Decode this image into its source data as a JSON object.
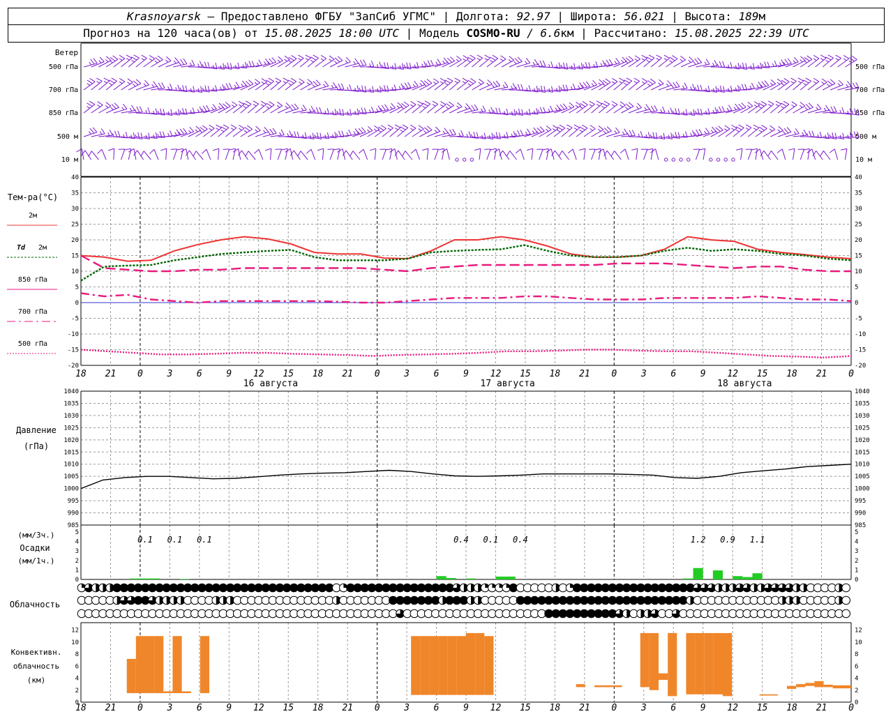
{
  "header": {
    "line1": {
      "city": "Krasnoyarsk",
      "sep": " — ",
      "provider": "Предоставлено ФГБУ \"ЗапСиб УГМС\"",
      "lon_label": "Долгота:",
      "lon_value": "92.97",
      "lat_label": "Широта:",
      "lat_value": "56.021",
      "alt_label": "Высота:",
      "alt_value": "189",
      "alt_unit": "м"
    },
    "line2": {
      "forecast_prefix": "Прогноз на 120 часа(ов) от",
      "forecast_time": "15.08.2025 18:00 UTC",
      "model_label": "Модель",
      "model_name": "COSMO-RU",
      "model_res": "/ 6.6",
      "model_res_unit": "км",
      "calc_label": "Рассчитано:",
      "calc_time": "15.08.2025 22:39 UTC"
    }
  },
  "chart_data": [
    {
      "panel": "wind",
      "type": "wind-barbs",
      "title": "Ветер",
      "levels": [
        "500 гПа",
        "700 гПа",
        "850 гПа",
        "500 м",
        "10 м"
      ],
      "note": "calm markers shown as circles at 10 м level"
    },
    {
      "panel": "temperature",
      "type": "line",
      "title": "Тем-ра(°C)",
      "ylim": [
        -20,
        40
      ],
      "yticks": [
        -20,
        -15,
        -10,
        -5,
        0,
        5,
        10,
        15,
        20,
        25,
        30,
        35,
        40
      ],
      "x_tick_labels": [
        "18",
        "21",
        "0",
        "3",
        "6",
        "9",
        "12",
        "15",
        "18",
        "21",
        "0",
        "3",
        "6",
        "9",
        "12",
        "15",
        "18",
        "21",
        "0",
        "3",
        "6",
        "9",
        "12",
        "15",
        "18",
        "21",
        "0"
      ],
      "day_labels": [
        {
          "at": 2,
          "text": "16 августа"
        },
        {
          "at": 10,
          "text": "17 августа"
        },
        {
          "at": 18,
          "text": "18 августа"
        }
      ],
      "x_hours": [
        0,
        3,
        6,
        9,
        12,
        15,
        18,
        21,
        24,
        27,
        30,
        33,
        36,
        39,
        42,
        45,
        48,
        51,
        54,
        57,
        60,
        63,
        66,
        69,
        72,
        75,
        78
      ],
      "series": [
        {
          "name": "2м",
          "color": "#ee3333",
          "dash": "solid",
          "values": [
            15,
            14.5,
            13.2,
            13.5,
            16.5,
            18.5,
            20,
            21,
            20.3,
            18.7,
            16,
            15.5,
            15.5,
            14.2,
            14,
            16.5,
            20,
            20,
            21,
            20,
            18,
            15.5,
            14.5,
            14.5,
            15,
            17,
            21,
            20,
            19.5,
            17,
            16,
            15.3,
            14.5,
            14
          ]
        },
        {
          "name": "Td 2м",
          "color": "#006600",
          "dash": "dot",
          "values": [
            7,
            11.5,
            11.8,
            12,
            13.5,
            14.5,
            15.5,
            16,
            16.5,
            16.8,
            14.5,
            13.5,
            13.5,
            13.5,
            14,
            16,
            16.5,
            16.8,
            17,
            18.3,
            16.5,
            15,
            14.5,
            14.5,
            15,
            16.5,
            17.5,
            16.5,
            17,
            16.5,
            15.5,
            15,
            14,
            13.5
          ]
        },
        {
          "name": "850 гПа",
          "color": "#e8197d",
          "dash": "long-dash",
          "values": [
            15,
            11,
            10.5,
            10,
            10,
            10.5,
            10.5,
            11,
            11,
            11,
            11,
            11,
            11,
            10.5,
            10,
            11,
            11.5,
            12,
            12,
            12,
            12,
            12,
            12,
            12.5,
            12.5,
            12.5,
            12,
            11.5,
            11,
            11.5,
            11.5,
            10.5,
            10,
            10
          ]
        },
        {
          "name": "700 гПа",
          "color": "#e8197d",
          "dash": "dash-dot",
          "values": [
            3,
            2,
            2.5,
            1,
            0.5,
            0,
            0.5,
            0.5,
            0.5,
            0.5,
            0.5,
            0.3,
            0,
            0,
            0.5,
            1,
            1.5,
            1.5,
            1.5,
            2,
            2,
            1.5,
            1,
            1,
            1,
            1.5,
            1.5,
            1.5,
            1.5,
            2,
            1.5,
            1,
            1,
            0.5
          ]
        },
        {
          "name": "500 гПа",
          "color": "#e8197d",
          "dash": "dense-dot",
          "values": [
            -15,
            -15.5,
            -16,
            -16.5,
            -16.5,
            -16.3,
            -16,
            -16,
            -16.3,
            -16.5,
            -16.7,
            -17,
            -16.7,
            -16.5,
            -16.3,
            -16,
            -15.5,
            -15.5,
            -15.3,
            -15,
            -15,
            -15.3,
            -15.5,
            -15.5,
            -16,
            -16.5,
            -17,
            -17.2,
            -17.5,
            -17
          ]
        }
      ]
    },
    {
      "panel": "pressure",
      "type": "line",
      "title": "Давление",
      "subtitle": "(гПа)",
      "ylim": [
        985,
        1040
      ],
      "yticks": [
        985,
        990,
        995,
        1000,
        1005,
        1010,
        1015,
        1020,
        1025,
        1030,
        1035,
        1040
      ],
      "series": [
        {
          "name": "",
          "color": "#000000",
          "values": [
            1000,
            1003.5,
            1004.5,
            1005,
            1005,
            1004.5,
            1004,
            1004.2,
            1004.8,
            1005.5,
            1006,
            1006.3,
            1006.5,
            1007,
            1007.5,
            1007,
            1006,
            1005.2,
            1005,
            1005.2,
            1005.5,
            1006,
            1006,
            1006,
            1006,
            1005.8,
            1005.5,
            1004.5,
            1004.2,
            1005,
            1006.5,
            1007.3,
            1008,
            1009,
            1009.5,
            1010
          ]
        }
      ]
    },
    {
      "panel": "precipitation",
      "type": "bar",
      "title": "Осадки",
      "ylabel_top": "(мм/3ч.)",
      "ylabel_bottom": "(мм/1ч.)",
      "ylim": [
        0,
        5
      ],
      "yticks": [
        0,
        1,
        2,
        3,
        4,
        5
      ],
      "labels_3h": [
        {
          "hour": 6.5,
          "text": "0.1"
        },
        {
          "hour": 9.5,
          "text": "0.1"
        },
        {
          "hour": 12.5,
          "text": "0.1"
        },
        {
          "hour": 38.5,
          "text": "0.4"
        },
        {
          "hour": 41.5,
          "text": "0.1"
        },
        {
          "hour": 44.5,
          "text": "0.4"
        },
        {
          "hour": 62.5,
          "text": "1.2"
        },
        {
          "hour": 65.5,
          "text": "0.9"
        },
        {
          "hour": 68.5,
          "text": "1.1"
        }
      ],
      "bars_1h": [
        {
          "hour": 5,
          "value": 0.1
        },
        {
          "hour": 6,
          "value": 0.1
        },
        {
          "hour": 7,
          "value": 0.1
        },
        {
          "hour": 10,
          "value": 0.05
        },
        {
          "hour": 36,
          "value": 0.35
        },
        {
          "hour": 37,
          "value": 0.15
        },
        {
          "hour": 39,
          "value": 0.1
        },
        {
          "hour": 42,
          "value": 0.3
        },
        {
          "hour": 43,
          "value": 0.3
        },
        {
          "hour": 61,
          "value": 0.1
        },
        {
          "hour": 62,
          "value": 1.2
        },
        {
          "hour": 64,
          "value": 0.95
        },
        {
          "hour": 66,
          "value": 0.35
        },
        {
          "hour": 67,
          "value": 0.25
        },
        {
          "hour": 68,
          "value": 0.65
        }
      ],
      "bar_color": "#22cc22"
    },
    {
      "panel": "cloudiness",
      "type": "symbol-grid",
      "title": "Облачность",
      "rows": [
        "high",
        "middle",
        "low"
      ],
      "coverage_scale": "0=clear, 1=quarter, 2=half, 3=three-quarter, 4=overcast",
      "values": {
        "high": [
          1,
          3,
          2,
          2,
          2,
          4,
          4,
          4,
          4,
          4,
          4,
          4,
          4,
          4,
          4,
          4,
          4,
          4,
          4,
          4,
          4,
          4,
          4,
          4,
          4,
          4,
          4,
          4,
          4,
          4,
          4,
          4,
          4,
          4,
          4,
          4,
          0,
          1,
          4,
          4,
          4,
          4,
          4,
          4,
          4,
          4,
          4,
          4,
          4,
          4,
          4,
          4,
          4,
          3,
          2,
          2,
          2,
          1,
          1,
          1,
          1,
          4,
          0,
          0,
          0,
          0,
          0,
          2,
          0,
          1,
          4,
          4,
          4,
          4,
          4,
          4,
          4,
          4,
          4,
          4,
          4,
          4,
          4,
          4,
          4,
          4,
          4,
          3,
          3,
          3,
          2,
          2,
          2,
          3,
          3,
          2,
          2,
          3,
          3,
          3,
          3,
          2,
          2,
          0,
          0,
          0,
          0,
          2,
          0
        ],
        "middle": [
          0,
          0,
          0,
          0,
          0,
          2,
          3,
          3,
          4,
          4,
          3,
          2,
          2,
          2,
          2,
          0,
          0,
          0,
          0,
          2,
          2,
          2,
          0,
          0,
          0,
          0,
          0,
          0,
          0,
          0,
          0,
          0,
          0,
          0,
          0,
          0,
          2,
          0,
          0,
          0,
          0,
          0,
          0,
          0,
          4,
          4,
          4,
          4,
          4,
          4,
          4,
          2,
          4,
          4,
          4,
          2,
          2,
          0,
          0,
          0,
          0,
          0,
          4,
          4,
          4,
          4,
          4,
          4,
          4,
          4,
          4,
          4,
          4,
          4,
          4,
          4,
          4,
          4,
          4,
          4,
          4,
          4,
          4,
          4,
          4,
          4,
          2,
          0,
          0,
          0,
          0,
          0,
          0,
          0,
          0,
          0,
          0,
          0,
          0,
          2,
          2,
          2,
          0,
          0,
          0,
          0,
          0,
          2,
          0
        ],
        "low": [
          0,
          0,
          0,
          0,
          0,
          0,
          0,
          0,
          0,
          0,
          0,
          0,
          0,
          0,
          0,
          0,
          0,
          0,
          0,
          0,
          0,
          0,
          0,
          0,
          0,
          0,
          0,
          0,
          0,
          0,
          0,
          0,
          0,
          0,
          0,
          0,
          0,
          0,
          0,
          0,
          0,
          0,
          0,
          0,
          0,
          3,
          0,
          0,
          0,
          0,
          0,
          0,
          0,
          0,
          0,
          0,
          0,
          0,
          0,
          0,
          0,
          0,
          0,
          0,
          0,
          0,
          4,
          4,
          4,
          4,
          4,
          4,
          4,
          4,
          4,
          4,
          3,
          2,
          0,
          2,
          2,
          3,
          0,
          0,
          3,
          0,
          0,
          0,
          0,
          0,
          0,
          0,
          0,
          0,
          0,
          0,
          0,
          0,
          0,
          0,
          0,
          0,
          0,
          0,
          0,
          0,
          0,
          0,
          0
        ]
      }
    },
    {
      "panel": "convective",
      "type": "range-bar",
      "title_lines": [
        "Конвективн.",
        "облачность",
        "(км)"
      ],
      "ylim": [
        0,
        13
      ],
      "yticks": [
        0,
        2,
        4,
        6,
        8,
        10,
        12
      ],
      "bar_color": "#f0862a",
      "bars": [
        {
          "h0": 5,
          "h1": 6,
          "base": 1.5,
          "top": 7.2
        },
        {
          "h0": 6,
          "h1": 7,
          "base": 1.5,
          "top": 11
        },
        {
          "h0": 7,
          "h1": 8,
          "base": 1.5,
          "top": 11
        },
        {
          "h0": 8,
          "h1": 9,
          "base": 1.5,
          "top": 11
        },
        {
          "h0": 9,
          "h1": 10,
          "base": 1.5,
          "top": 1.8
        },
        {
          "h0": 10,
          "h1": 11,
          "base": 1.5,
          "top": 11
        },
        {
          "h0": 11,
          "h1": 12,
          "base": 1.5,
          "top": 1.8
        },
        {
          "h0": 13,
          "h1": 14,
          "base": 1.5,
          "top": 11
        },
        {
          "h0": 36,
          "h1": 37,
          "base": 1.2,
          "top": 11
        },
        {
          "h0": 37,
          "h1": 38,
          "base": 1.2,
          "top": 11
        },
        {
          "h0": 38,
          "h1": 39,
          "base": 1.2,
          "top": 11
        },
        {
          "h0": 39,
          "h1": 40,
          "base": 1.2,
          "top": 11
        },
        {
          "h0": 40,
          "h1": 41,
          "base": 1.2,
          "top": 11
        },
        {
          "h0": 41,
          "h1": 42,
          "base": 1.2,
          "top": 11
        },
        {
          "h0": 42,
          "h1": 43,
          "base": 1.2,
          "top": 11.5
        },
        {
          "h0": 43,
          "h1": 44,
          "base": 1.2,
          "top": 11.5
        },
        {
          "h0": 44,
          "h1": 45,
          "base": 1.2,
          "top": 11
        },
        {
          "h0": 54,
          "h1": 55,
          "base": 2.5,
          "top": 3
        },
        {
          "h0": 56,
          "h1": 57,
          "base": 2.5,
          "top": 2.8
        },
        {
          "h0": 57,
          "h1": 58,
          "base": 2.5,
          "top": 2.8
        },
        {
          "h0": 58,
          "h1": 59,
          "base": 2.5,
          "top": 2.8
        },
        {
          "h0": 61,
          "h1": 62,
          "base": 2.5,
          "top": 11.5
        },
        {
          "h0": 62,
          "h1": 63,
          "base": 2,
          "top": 11.5
        },
        {
          "h0": 63,
          "h1": 64,
          "base": 3.7,
          "top": 4.8
        },
        {
          "h0": 64,
          "h1": 65,
          "base": 1,
          "top": 11.5
        },
        {
          "h0": 66,
          "h1": 67,
          "base": 1.3,
          "top": 11.5
        },
        {
          "h0": 67,
          "h1": 68,
          "base": 1.3,
          "top": 11.5
        },
        {
          "h0": 68,
          "h1": 69,
          "base": 1.3,
          "top": 11.5
        },
        {
          "h0": 69,
          "h1": 70,
          "base": 1.3,
          "top": 11.5
        },
        {
          "h0": 70,
          "h1": 71,
          "base": 1,
          "top": 11.5
        },
        {
          "h0": 74,
          "h1": 76,
          "base": 1.1,
          "top": 1.3
        },
        {
          "h0": 77,
          "h1": 78,
          "base": 2.2,
          "top": 2.7
        },
        {
          "h0": 78,
          "h1": 79,
          "base": 2.5,
          "top": 3
        },
        {
          "h0": 79,
          "h1": 80,
          "base": 2.7,
          "top": 3.2
        },
        {
          "h0": 80,
          "h1": 81,
          "base": 2.5,
          "top": 3.5
        },
        {
          "h0": 81,
          "h1": 82,
          "base": 2.5,
          "top": 2.9
        },
        {
          "h0": 82,
          "h1": 84,
          "base": 2.3,
          "top": 2.8
        }
      ]
    }
  ],
  "legend": {
    "temperature": [
      {
        "label": "2м",
        "color": "#ee3333",
        "style": "solid"
      },
      {
        "label_bold": "Td",
        "label": "2м",
        "color": "#006600",
        "style": "dot"
      },
      {
        "label": "850 гПа",
        "color": "#e8197d",
        "style": "solid"
      },
      {
        "label": "700 гПа",
        "color": "#e8197d",
        "style": "dash-dot"
      },
      {
        "label": "500 гПа",
        "color": "#e8197d",
        "style": "dense-dot"
      }
    ]
  },
  "colors": {
    "wind": "#7b17cc",
    "grid": "#9a9a9a",
    "zero_line": "#3333cc",
    "precip": "#22cc22",
    "convective": "#f0862a"
  }
}
